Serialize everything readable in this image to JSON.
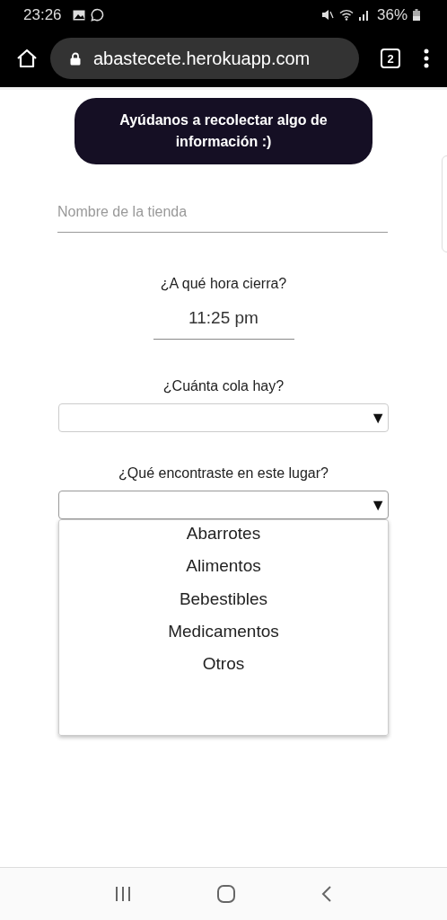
{
  "status_bar": {
    "time": "23:26",
    "battery": "36%"
  },
  "browser": {
    "url": "abastecete.herokuapp.com",
    "tab_count": "2"
  },
  "banner": "Ayúdanos a recolectar algo de información :)",
  "store_field": {
    "placeholder": "Nombre de la tienda"
  },
  "closing_time": {
    "label": "¿A qué hora cierra?",
    "value": "11:25 pm"
  },
  "queue_select": {
    "label": "¿Cuánta cola hay?",
    "arrow": "▼",
    "expanded": false
  },
  "found_select": {
    "label": "¿Qué encontraste en este lugar?",
    "arrow": "▼",
    "expanded": true,
    "options": [
      {
        "label": "Abarrotes"
      },
      {
        "label": "Alimentos"
      },
      {
        "label": "Bebestibles"
      },
      {
        "label": "Medicamentos"
      },
      {
        "label": "Otros"
      }
    ]
  }
}
